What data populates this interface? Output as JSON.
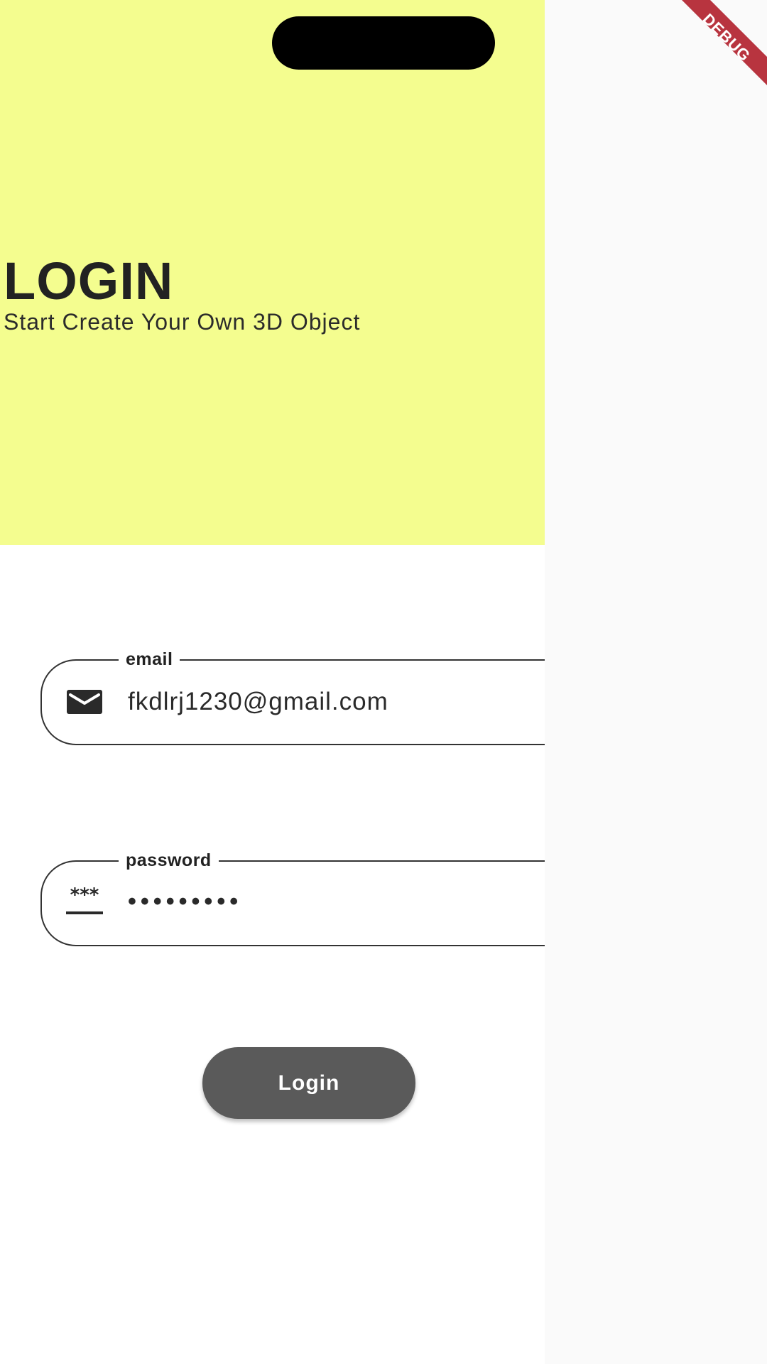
{
  "header": {
    "title": "LOGIN",
    "subtitle": "Start Create Your Own 3D Object",
    "background_color": "#f4fd8f"
  },
  "form": {
    "email": {
      "label": "email",
      "value": "fkdlrj1230@gmail.com",
      "icon": "mail-icon"
    },
    "password": {
      "label": "password",
      "value": "•••••••••",
      "icon": "password-stars-icon",
      "icon_text": "***"
    },
    "submit_label": "Login",
    "button_color": "#5a5a5a"
  },
  "debug_banner": {
    "label": "DEBUG",
    "color": "#b8343f"
  }
}
